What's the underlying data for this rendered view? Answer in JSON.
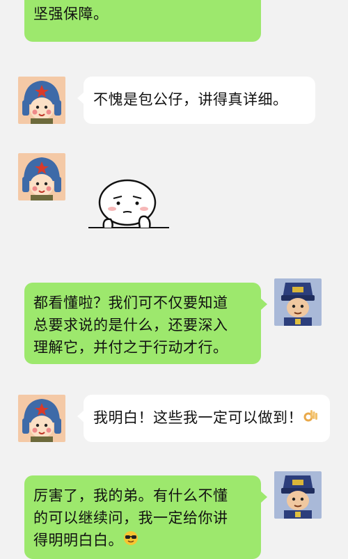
{
  "colors": {
    "background": "#f2f2f2",
    "green_bubble": "#9de86d",
    "white_bubble": "#ffffff"
  },
  "messages": [
    {
      "side": "right",
      "style": "green",
      "lines": [
        "坚强保障。"
      ]
    },
    {
      "side": "left",
      "style": "white",
      "lines": [
        "不愧是包公仔，讲得真详细。"
      ]
    },
    {
      "side": "left",
      "style": "sticker",
      "sticker": "thinking-face-sticker"
    },
    {
      "side": "right",
      "style": "green",
      "lines": [
        "都看懂啦？我们可不仅要知道",
        "总要求说的是什么，还要深入",
        "理解它，并付之于行动才行。"
      ]
    },
    {
      "side": "left",
      "style": "white",
      "lines": [
        "我明白！这些我一定可以做到！"
      ],
      "emoji": "ok-hand-emoji"
    },
    {
      "side": "right",
      "style": "green",
      "lines": [
        "厉害了，我的弟。有什么不懂",
        "的可以继续问，我一定给你讲",
        "得明明白白。"
      ],
      "emoji": "sunglasses-emoji"
    }
  ]
}
